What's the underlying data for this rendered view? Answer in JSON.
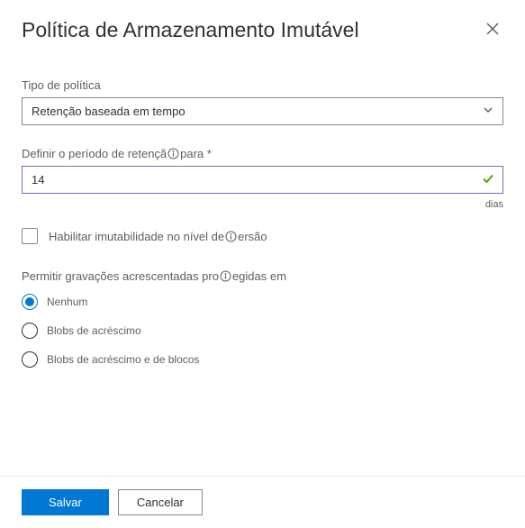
{
  "header": {
    "title": "Política de Armazenamento Imutável"
  },
  "policy_type": {
    "label": "Tipo de política",
    "selected": "Retenção baseada em tempo"
  },
  "retention": {
    "label_prefix": "Definir o período de retençã",
    "label_suffix": "para *",
    "value": "14",
    "unit": "dias"
  },
  "version_level": {
    "label_prefix": "Habilitar imutabilidade no nível de",
    "label_suffix": "ersão"
  },
  "append_writes": {
    "label_prefix": "Permitir gravações acrescentadas pro",
    "label_suffix": "egidas em",
    "options": [
      {
        "label": "Nenhum",
        "selected": true
      },
      {
        "label": "Blobs de acréscimo",
        "selected": false
      },
      {
        "label": "Blobs de acréscimo e de blocos",
        "selected": false
      }
    ]
  },
  "footer": {
    "save": "Salvar",
    "cancel": "Cancelar"
  }
}
